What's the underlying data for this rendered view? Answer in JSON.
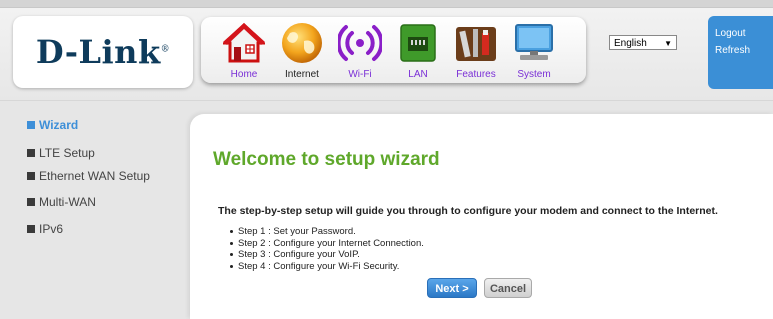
{
  "header": {
    "logo_text": "D-Link",
    "logo_mark": "®"
  },
  "nav": [
    {
      "label": "Home",
      "icon": "home-icon"
    },
    {
      "label": "Internet",
      "icon": "globe-icon"
    },
    {
      "label": "Wi-Fi",
      "icon": "wifi-icon"
    },
    {
      "label": "LAN",
      "icon": "lan-icon"
    },
    {
      "label": "Features",
      "icon": "tools-icon"
    },
    {
      "label": "System",
      "icon": "computer-icon"
    }
  ],
  "language": {
    "selected": "English"
  },
  "account": {
    "logout": "Logout",
    "refresh": "Refresh"
  },
  "sidebar": {
    "items": [
      {
        "label": "Wizard"
      },
      {
        "label": "LTE Setup"
      },
      {
        "label": "Ethernet WAN Setup"
      },
      {
        "label": "Multi-WAN"
      },
      {
        "label": "IPv6"
      }
    ]
  },
  "main": {
    "title": "Welcome to setup wizard",
    "intro": "The step-by-step setup will guide you through to configure your modem and connect to the Internet.",
    "steps": [
      "Step 1 : Set your Password.",
      "Step 2 : Configure your Internet Connection.",
      "Step 3 : Configure your VoIP.",
      "Step 4 : Configure your Wi-Fi Security."
    ],
    "next_label": "Next >",
    "cancel_label": "Cancel"
  },
  "colors": {
    "accent_blue": "#3b8fd6",
    "title_green": "#5fa82b",
    "nav_label_purple": "#7a2fd6",
    "logo_navy": "#0e3b5b"
  }
}
